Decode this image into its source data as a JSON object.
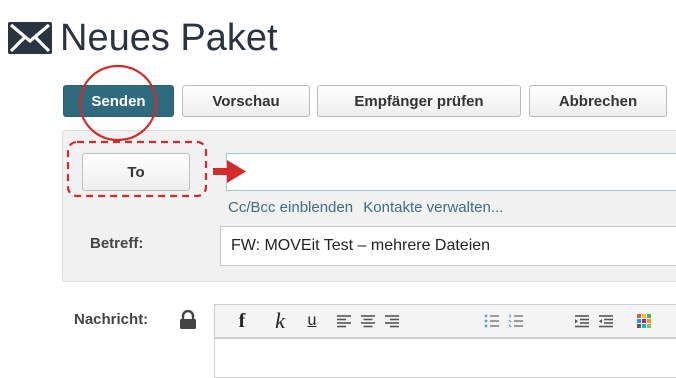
{
  "page": {
    "title": "Neues Paket",
    "title_icon": "envelope-icon"
  },
  "toolbar": {
    "send_label": "Senden",
    "preview_label": "Vorschau",
    "check_recipients_label": "Empfänger prüfen",
    "cancel_label": "Abbrechen"
  },
  "recipients": {
    "to_button_label": "To",
    "to_value": "",
    "cc_bcc_link": "Cc/Bcc einblenden",
    "contacts_link": "Kontakte verwalten..."
  },
  "subject": {
    "label": "Betreff:",
    "value": "FW: MOVEit Test – mehrere Dateien"
  },
  "message": {
    "label": "Nachricht:",
    "lock_icon": "lock-icon",
    "format_buttons": {
      "bold": "f",
      "italic": "k",
      "underline": "u"
    },
    "format_icons": [
      "align-left-icon",
      "align-center-icon",
      "align-right-icon",
      "bullet-list-icon",
      "numbered-list-icon",
      "outdent-icon",
      "indent-icon",
      "color-icon"
    ]
  },
  "colors": {
    "primary": "#2e6b7e",
    "annotation_red": "#d42a2a",
    "link": "#3f6f7e",
    "input_focus_border": "#9ccad6"
  },
  "annotations": [
    "red-circle-highlight",
    "red-dashed-box",
    "red-arrow-icon"
  ]
}
